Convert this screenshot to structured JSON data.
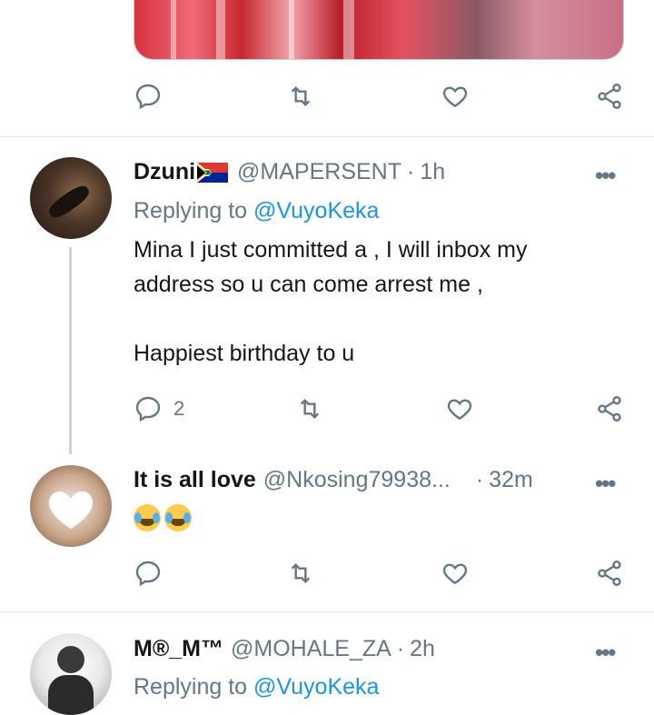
{
  "tweets": [
    {
      "name": "Dzuni",
      "flag": "south-africa-flag-emoji",
      "handle": "@MAPERSENT",
      "sep": "·",
      "time": "1h",
      "replying_prefix": "Replying to",
      "replying_handle": "@VuyoKeka",
      "body_line1": "Mina I just committed a , I will inbox my",
      "body_line2": "address so u can come arrest me ,",
      "body_line3": "Happiest birthday to u",
      "reply_count": "2"
    },
    {
      "name": "It is all love",
      "handle": "@Nkosing79938...",
      "sep": "·",
      "time": "32m",
      "body_emoji": [
        "face-with-tears-of-joy",
        "face-with-tears-of-joy"
      ]
    },
    {
      "name": "M®_M™",
      "handle": "@MOHALE_ZA",
      "sep": "·",
      "time": "2h",
      "replying_prefix": "Replying to",
      "replying_handle": "@VuyoKeka"
    }
  ],
  "more_label": "•••",
  "colors": {
    "accent": "#1b95e0",
    "muted": "#657786",
    "text": "#14171a",
    "divider": "#e1e8ed"
  },
  "icons": [
    "reply-icon",
    "retweet-icon",
    "like-icon",
    "share-icon",
    "more-icon"
  ]
}
